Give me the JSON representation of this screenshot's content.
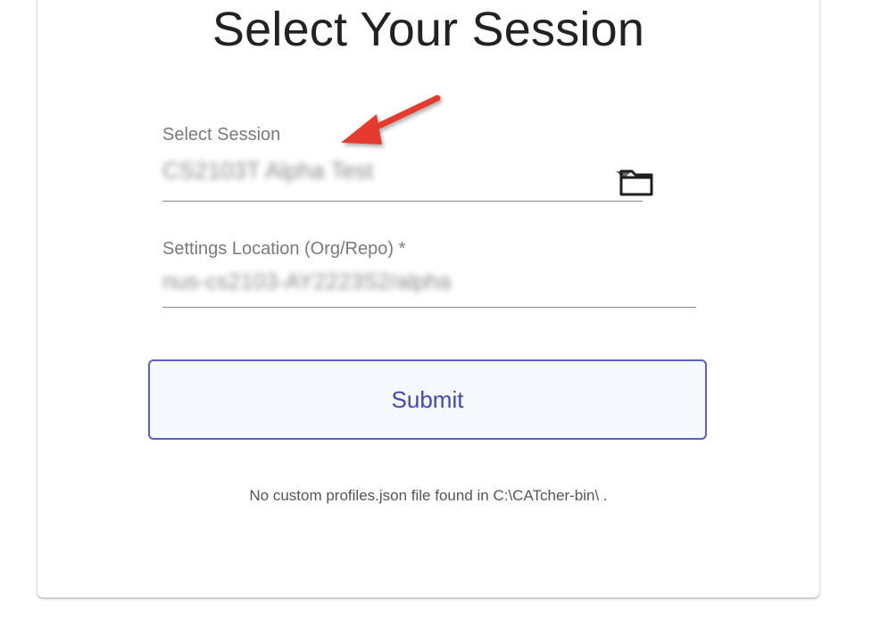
{
  "page": {
    "title": "Select Your Session"
  },
  "session_field": {
    "label": "Select Session",
    "value": "CS2103T Alpha Test",
    "value_blurred": true,
    "dropdown_icon": "caret-down-icon",
    "folder_icon": "folder-icon"
  },
  "settings_field": {
    "label": "Settings Location (Org/Repo) *",
    "value": "nus-cs2103-AY2223S2/alpha",
    "value_blurred": true
  },
  "submit": {
    "label": "Submit"
  },
  "footnote": "No custom profiles.json file found in C:\\CATcher-bin\\ .",
  "annotation": {
    "icon": "red-arrow-icon",
    "color": "#e53a2f"
  },
  "colors": {
    "accent": "#4047b8",
    "button_bg": "#f5f9fe",
    "label": "#7a7a7a",
    "title": "#222222"
  }
}
